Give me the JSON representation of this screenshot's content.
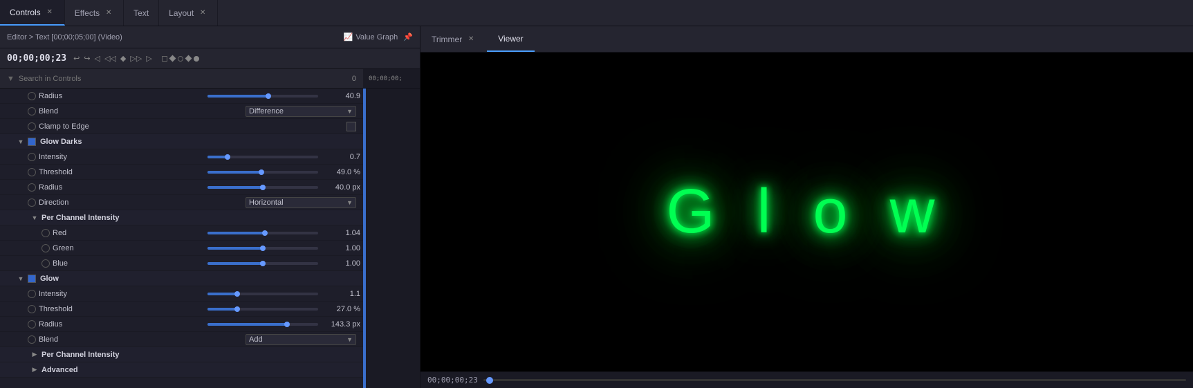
{
  "tabs": {
    "left": [
      {
        "id": "controls",
        "label": "Controls",
        "active": true,
        "closable": true
      },
      {
        "id": "effects",
        "label": "Effects",
        "active": false,
        "closable": true
      },
      {
        "id": "text",
        "label": "Text",
        "active": false,
        "closable": false
      },
      {
        "id": "layout",
        "label": "Layout",
        "active": false,
        "closable": true
      }
    ],
    "right": [
      {
        "id": "trimmer",
        "label": "Trimmer",
        "active": false,
        "closable": true
      },
      {
        "id": "viewer",
        "label": "Viewer",
        "active": true,
        "closable": false
      }
    ]
  },
  "editor": {
    "breadcrumb": "Editor > Text [00;00;05;00] (Video)",
    "value_graph_label": "Value Graph",
    "timecode": "00;00;00;23",
    "timeline_time": "00;00;00;"
  },
  "search": {
    "placeholder": "Search in Controls"
  },
  "controls": [
    {
      "type": "control",
      "indent": 2,
      "input": "radio",
      "label": "Radius",
      "slider_pct": 55,
      "value": "40.9"
    },
    {
      "type": "control",
      "indent": 2,
      "input": "radio",
      "label": "Blend",
      "dropdown": true,
      "dropdown_value": "Difference"
    },
    {
      "type": "control",
      "indent": 2,
      "input": "radio",
      "label": "Clamp to Edge",
      "checkbox_display": true
    },
    {
      "type": "section",
      "indent": 1,
      "label": "Glow Darks",
      "has_checkbox": true
    },
    {
      "type": "control",
      "indent": 2,
      "input": "radio",
      "label": "Intensity",
      "slider_pct": 18,
      "value": "0.7"
    },
    {
      "type": "control",
      "indent": 2,
      "input": "radio",
      "label": "Threshold",
      "slider_pct": 49,
      "value": "49.0 %"
    },
    {
      "type": "control",
      "indent": 2,
      "input": "radio",
      "label": "Radius",
      "slider_pct": 50,
      "value": "40.0 px"
    },
    {
      "type": "control",
      "indent": 2,
      "input": "radio",
      "label": "Direction",
      "dropdown": true,
      "dropdown_value": "Horizontal"
    },
    {
      "type": "section",
      "indent": 1,
      "label": "Per Channel Intensity",
      "has_checkbox": false,
      "sub": true
    },
    {
      "type": "control",
      "indent": 3,
      "input": "radio",
      "label": "Red",
      "slider_pct": 52,
      "value": "1.04"
    },
    {
      "type": "control",
      "indent": 3,
      "input": "radio",
      "label": "Green",
      "slider_pct": 50,
      "value": "1.00"
    },
    {
      "type": "control",
      "indent": 3,
      "input": "radio",
      "label": "Blue",
      "slider_pct": 50,
      "value": "1.00"
    },
    {
      "type": "section",
      "indent": 1,
      "label": "Glow",
      "has_checkbox": true
    },
    {
      "type": "control",
      "indent": 2,
      "input": "radio",
      "label": "Intensity",
      "slider_pct": 27,
      "value": "1.1"
    },
    {
      "type": "control",
      "indent": 2,
      "input": "radio",
      "label": "Threshold",
      "slider_pct": 27,
      "value": "27.0 %"
    },
    {
      "type": "control",
      "indent": 2,
      "input": "radio",
      "label": "Radius",
      "slider_pct": 72,
      "value": "143.3 px"
    },
    {
      "type": "control",
      "indent": 2,
      "input": "radio",
      "label": "Blend",
      "dropdown": true,
      "dropdown_value": "Add"
    },
    {
      "type": "section",
      "indent": 1,
      "label": "Per Channel Intensity",
      "has_checkbox": false,
      "sub": true,
      "collapsed": true
    },
    {
      "type": "section",
      "indent": 1,
      "label": "Advanced",
      "has_checkbox": false,
      "sub": true,
      "collapsed": true
    }
  ],
  "viewer": {
    "glow_text": "G l o w",
    "timecode": "00;00;00;23"
  }
}
